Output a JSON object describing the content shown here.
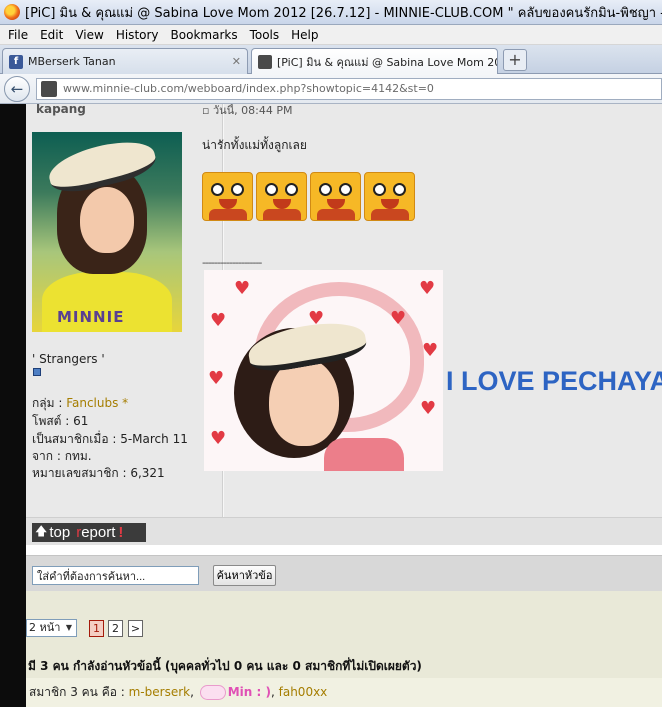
{
  "window": {
    "title": "[PiC] มิน & คุณแม่ @ Sabina Love Mom 2012 [26.7.12] - MINNIE-CLUB.COM \" คลับของคนรักมิน-พิชญา - Mozilla Firefox"
  },
  "menu": {
    "items": [
      "File",
      "Edit",
      "View",
      "History",
      "Bookmarks",
      "Tools",
      "Help"
    ]
  },
  "tabs": [
    {
      "label": "MBerserk Tanan",
      "favicon": "facebook-icon",
      "active": false
    },
    {
      "label": "[PiC] มิน & คุณแม่ @ Sabina Love Mom 20...",
      "favicon": "site-icon",
      "active": true
    }
  ],
  "nav": {
    "url": "www.minnie-club.com/webboard/index.php?showtopic=4142&st=0"
  },
  "post": {
    "username": "kapang",
    "time": "วันนี้, 08:44 PM",
    "avatar_signature": "MINNIE",
    "group_label": "' Strangers '",
    "info": [
      {
        "label": "กลุ่ม : ",
        "value": "Fanclubs *"
      },
      {
        "label": "โพสต์ : ",
        "value": "61"
      },
      {
        "label": "เป็นสมาชิกเมื่อ : ",
        "value": "5-March 11"
      },
      {
        "label": "จาก : ",
        "value": "กทม."
      },
      {
        "label": "หมายเลขสมาชิก : ",
        "value": "6,321"
      }
    ],
    "message": "น่ารักทั้งแม่ทั้งลูกเลย",
    "divider": "--------------------",
    "love_text": "I LOVE PECHAYA",
    "top_label": "top",
    "report_first": "r",
    "report_rest": "eport",
    "report_excl": "!"
  },
  "search": {
    "placeholder": "ใส่คำที่ต้องการค้นหา...",
    "button_label": "ค้นหาหัวข้อ"
  },
  "pager": {
    "select_label": "2 หน้า",
    "pages": [
      "1",
      "2"
    ],
    "current": "1",
    "next": ">"
  },
  "online": {
    "summary": "มี 3 คน กำลังอ่านหัวข้อนี้ (บุคคลทั่วไป 0 คน และ 0 สมาชิกที่ไม่เปิดเผยตัว)",
    "members_label": "สมาชิก 3 คน คือ : ",
    "members": [
      "m-berserk",
      "Min : )",
      "fah00xx"
    ]
  },
  "colors": {
    "love_text": "#2d64c3",
    "link": "#a57d00",
    "rank_icon": "#4e7fc4"
  }
}
